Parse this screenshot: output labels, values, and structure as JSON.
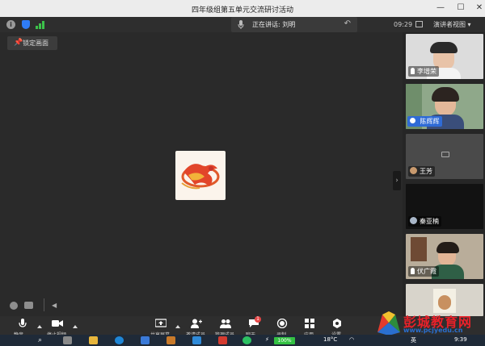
{
  "window": {
    "title": "四年级组第五单元交流研讨活动",
    "minimize": "—",
    "maximize": "☐",
    "close": "✕"
  },
  "status": {
    "speaking_label": "正在讲话: 刘明",
    "time": "09:29",
    "view_mode": "演讲者视图 ▾"
  },
  "stage": {
    "lock_screen_label": "锁定画面"
  },
  "participants": [
    {
      "name": "李增荣"
    },
    {
      "name": "陈辉辉"
    },
    {
      "name": "王芳"
    },
    {
      "name": "秦亚楠"
    },
    {
      "name": "伏广霞"
    }
  ],
  "toolbar": {
    "labels": [
      "静音",
      "停止视频",
      "共享屏幕",
      "邀请成员",
      "管理成员",
      "聊天",
      "录制",
      "应用",
      "设置"
    ],
    "chat_badge": "1"
  },
  "taskbar": {
    "weather": "18°C",
    "battery": "100%",
    "ime": "英",
    "clock": "9:39"
  },
  "watermark": {
    "title": "彭城教育网",
    "url": "www.pcjyedu.cn"
  }
}
